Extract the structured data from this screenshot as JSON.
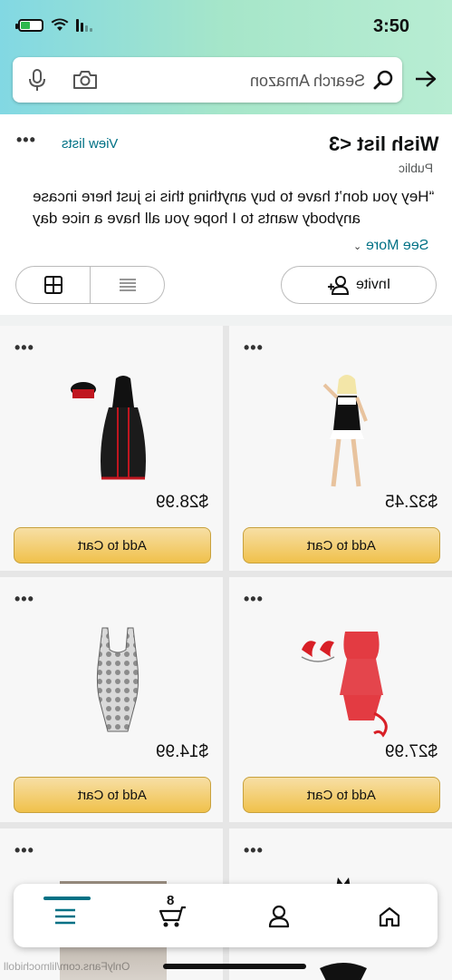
{
  "status": {
    "time": "3:50"
  },
  "search": {
    "placeholder": "Search Amazon"
  },
  "wishlist": {
    "title": "Wish list <3",
    "privacy": "Public",
    "view_lists": "View lists",
    "description": "“Hey you don’t have to buy anything this is just here incase anybody wants to I hope you all have a nice day",
    "see_more": "See More",
    "invite_label": "Invite"
  },
  "products": [
    {
      "price": "$32.45",
      "cart_label": "Add to Cart",
      "image": "maid-costume-photo"
    },
    {
      "price": "$28.99",
      "cart_label": "Add to Cart",
      "image": "nurse-dress-photo"
    },
    {
      "price": "$27.99",
      "cart_label": "Add to Cart",
      "image": "red-devil-lingerie-photo"
    },
    {
      "price": "$14.99",
      "cart_label": "Add to Cart",
      "image": "floral-bodysuit-photo"
    }
  ],
  "nav": {
    "cart_count": "8"
  },
  "watermark": "OnlyFans.com/lilmochidoll",
  "colors": {
    "accent": "#007185",
    "cart_button": "#f0c14b",
    "header_start": "#82d8e3",
    "header_end": "#b8edd3"
  }
}
